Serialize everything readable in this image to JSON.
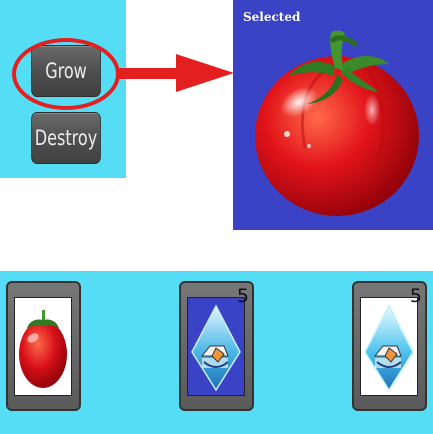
{
  "controls": {
    "grow_label": "Grow",
    "destroy_label": "Destroy"
  },
  "selected": {
    "label": "Selected",
    "item_icon": "tomato"
  },
  "inventory": [
    {
      "item_icon": "tomato",
      "count": ""
    },
    {
      "item_icon": "water-drop-seed",
      "count": "5"
    },
    {
      "item_icon": "water-drop-seed",
      "count": "5"
    }
  ],
  "colors": {
    "panel_cyan": "#55ddf6",
    "selected_bg": "#3a43c5",
    "highlight_red": "#e41f1f"
  }
}
